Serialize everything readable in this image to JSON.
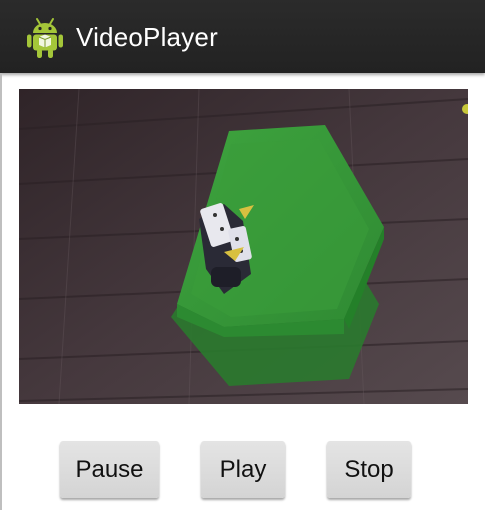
{
  "actionbar": {
    "title": "VideoPlayer",
    "icon": "android-robot-icon",
    "background": "#242424"
  },
  "video": {
    "content": "video-frame",
    "floor_color": "#3d3035",
    "tray_color": "#3a9a3a"
  },
  "controls": {
    "pause_label": "Pause",
    "play_label": "Play",
    "stop_label": "Stop",
    "button_color": "#dcdcdc"
  }
}
